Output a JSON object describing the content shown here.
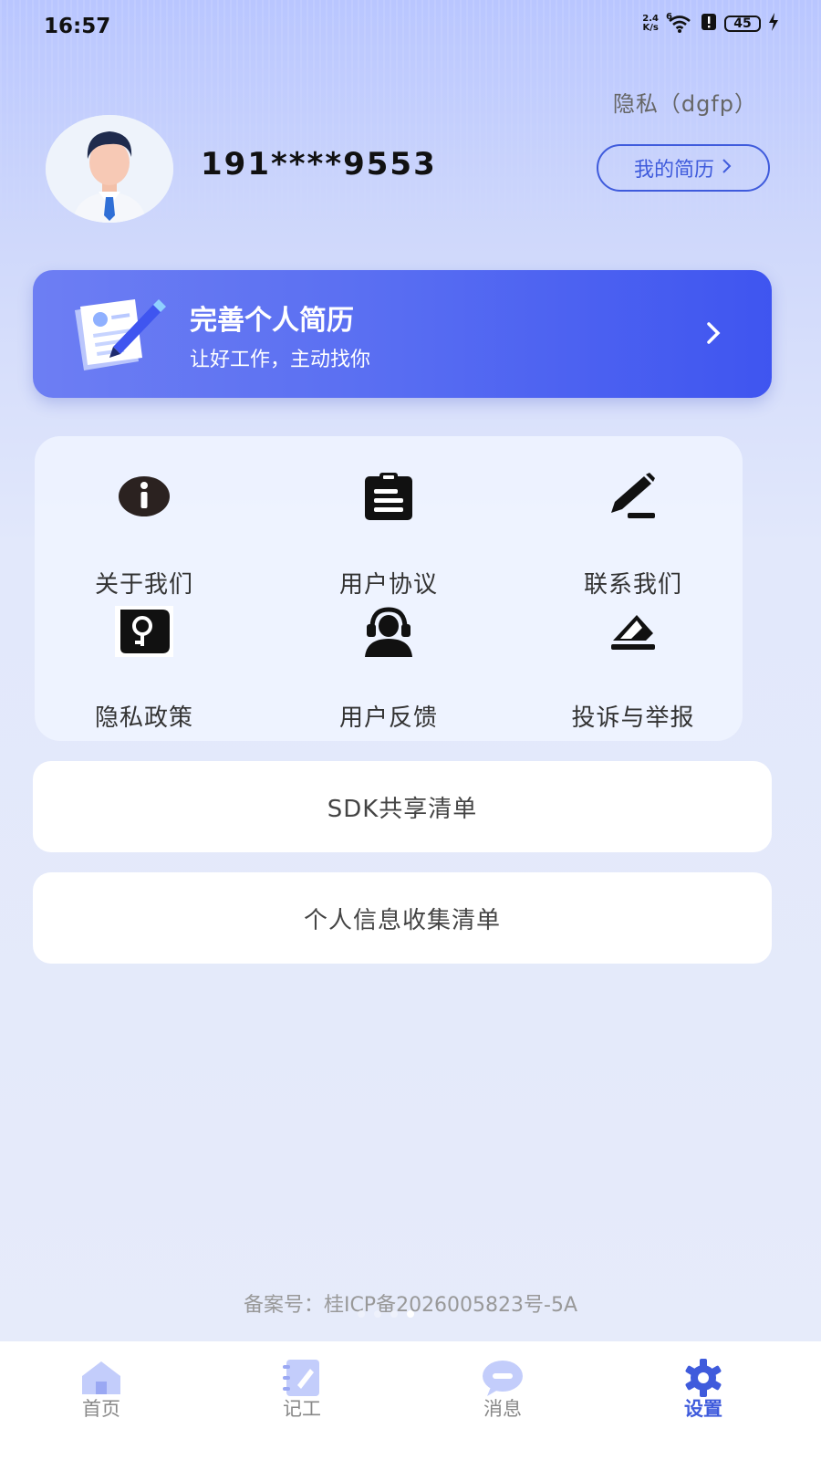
{
  "status_bar": {
    "time": "16:57",
    "net_speed_value": "2.4",
    "net_speed_unit": "K/s",
    "signal_label": "6",
    "battery": "45"
  },
  "profile": {
    "privacy_link": "隐私（dgfp）",
    "phone": "191****9553",
    "resume_button": "我的简历"
  },
  "banner": {
    "title": "完善个人简历",
    "subtitle": "让好工作，主动找你"
  },
  "grid": {
    "items": [
      {
        "label": "关于我们",
        "icon": "info-icon"
      },
      {
        "label": "用户协议",
        "icon": "clipboard-icon"
      },
      {
        "label": "联系我们",
        "icon": "pen-icon"
      },
      {
        "label": "隐私政策",
        "icon": "key-icon"
      },
      {
        "label": "用户反馈",
        "icon": "headset-icon"
      },
      {
        "label": "投诉与举报",
        "icon": "eraser-icon"
      }
    ]
  },
  "lists": {
    "sdk": "SDK共享清单",
    "personal_info": "个人信息收集清单"
  },
  "footer": {
    "icp": "备案号：桂ICP备2026005823号-5A"
  },
  "tabbar": {
    "items": [
      {
        "label": "首页",
        "icon": "home-icon"
      },
      {
        "label": "记工",
        "icon": "notebook-icon"
      },
      {
        "label": "消息",
        "icon": "message-icon"
      },
      {
        "label": "设置",
        "icon": "gear-icon"
      }
    ],
    "active": "设置"
  },
  "colors": {
    "accent": "#3f5bdc",
    "banner_start": "#6d7ef3",
    "banner_end": "#3f55f0"
  }
}
